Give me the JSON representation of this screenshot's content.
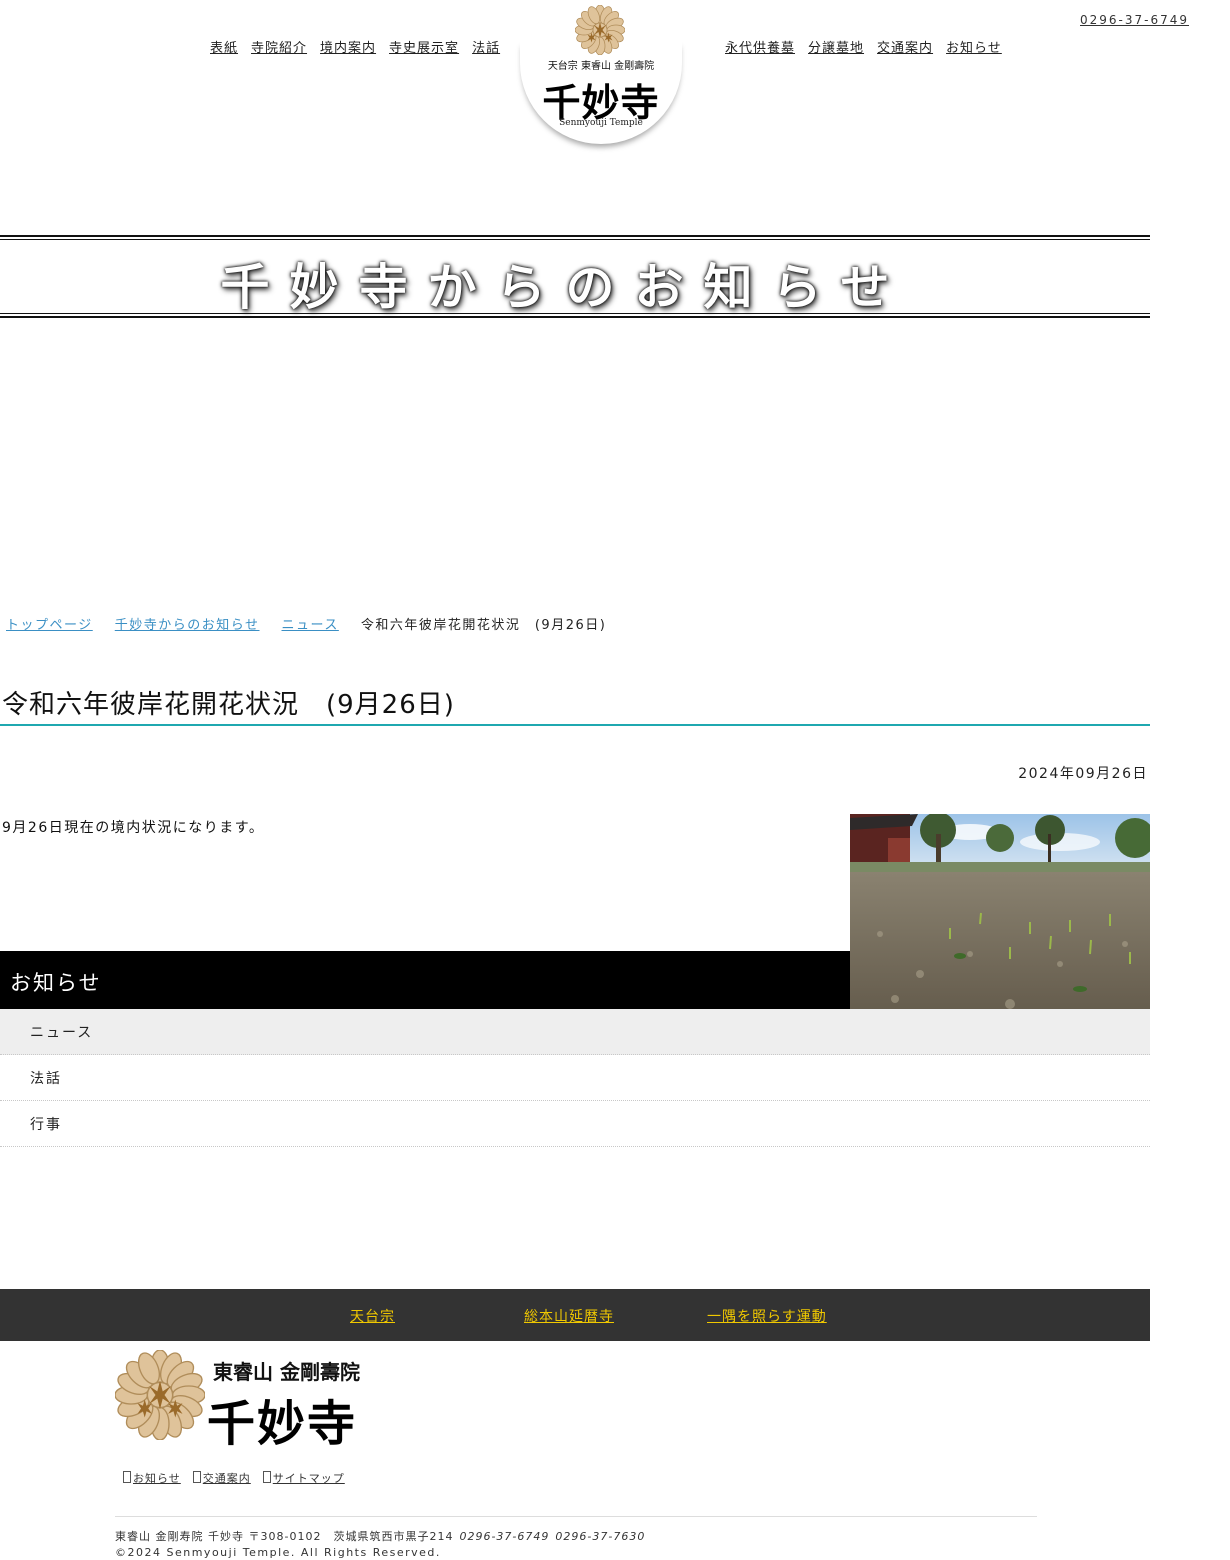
{
  "header": {
    "nav_left": [
      "表紙",
      "寺院紹介",
      "境内案内",
      "寺史展示室",
      "法話"
    ],
    "nav_right": [
      "永代供養墓",
      "分譲墓地",
      "交通案内",
      "お知らせ"
    ],
    "phone": "0296-37-6749",
    "logo": {
      "subtitle": "天台宗 東睿山 金剛壽院",
      "name": "千妙寺",
      "english": "Senmyouji Temple"
    }
  },
  "page_banner": {
    "title": "千妙寺からのお知らせ"
  },
  "breadcrumb": {
    "items": [
      "トップページ",
      "千妙寺からのお知らせ",
      "ニュース"
    ],
    "current": "令和六年彼岸花開花状況　(9月26日)"
  },
  "article": {
    "title": "令和六年彼岸花開花状況　(9月26日)",
    "date": "2024年09月26日",
    "body": "9月26日現在の境内状況になります。"
  },
  "sidebar": {
    "heading": "お知らせ",
    "items": [
      "ニュース",
      "法話",
      "行事"
    ]
  },
  "footer": {
    "links": [
      "天台宗",
      "総本山延暦寺",
      "一隅を照らす運動"
    ],
    "logo_subtitle": "東睿山 金剛壽院",
    "logo_name": "千妙寺",
    "sub_links": [
      "お知らせ",
      "交通案内",
      "サイトマップ"
    ],
    "address": "東睿山 金剛寿院 千妙寺 〒308-0102　茨城県筑西市黒子214",
    "tel": "0296-37-6749",
    "fax": "0296-37-7630",
    "copyright": "©2024 Senmyouji Temple. All Rights Reserved."
  },
  "colors": {
    "accent_rule": "#1fa8b0",
    "breadcrumb_link": "#3a8fc4",
    "footer_link": "#f0c800",
    "footer_bar": "#333333"
  }
}
